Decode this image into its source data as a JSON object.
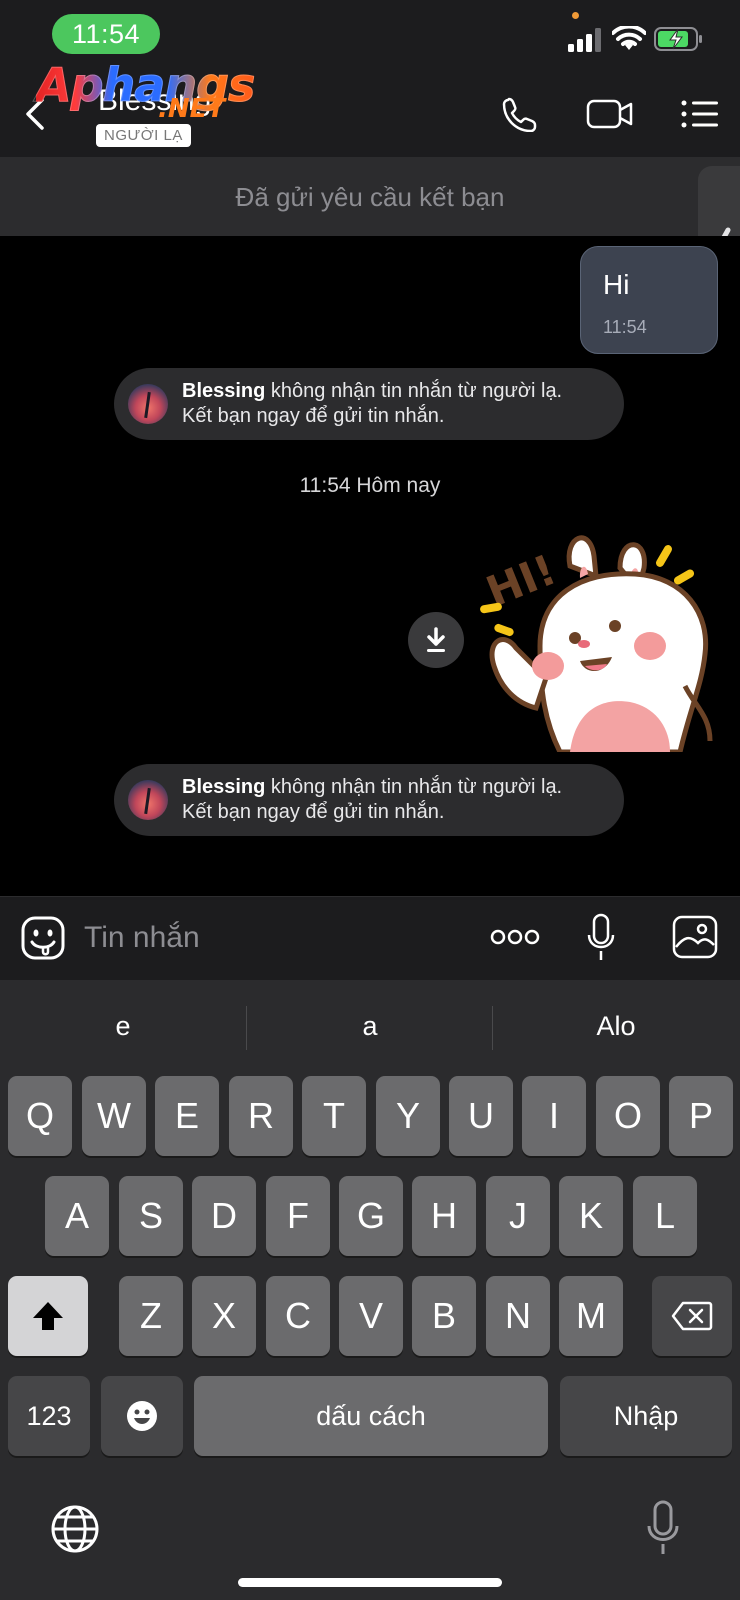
{
  "status": {
    "time": "11:54"
  },
  "header": {
    "contact_name": "Blessing",
    "stranger_tag": "NGƯỜI LẠ",
    "watermark_main": "Aphangs",
    "watermark_sub": ".NET"
  },
  "friend_banner": "Đã gửi yêu cầu kết bạn",
  "messages": {
    "outgoing": {
      "text": "Hi",
      "time": "11:54"
    },
    "notice": {
      "name": "Blessing",
      "line1_rest": " không nhận tin nhắn từ người lạ.",
      "line2": "Kết bạn ngay để gửi tin nhắn."
    },
    "time_divider": "11:54 Hôm nay",
    "sticker_text": "HI!"
  },
  "input": {
    "placeholder": "Tin nhắn"
  },
  "keyboard": {
    "suggestions": [
      "e",
      "a",
      "Alo"
    ],
    "row1": [
      "Q",
      "W",
      "E",
      "R",
      "T",
      "Y",
      "U",
      "I",
      "O",
      "P"
    ],
    "row2": [
      "A",
      "S",
      "D",
      "F",
      "G",
      "H",
      "J",
      "K",
      "L"
    ],
    "row3": [
      "Z",
      "X",
      "C",
      "V",
      "B",
      "N",
      "M"
    ],
    "numbers_label": "123",
    "space_label": "dấu cách",
    "return_label": "Nhập"
  },
  "colors": {
    "time_pill": "#4cc75e",
    "outgoing_bubble": "#3d4350",
    "keyboard_bg": "#2b2b2d"
  }
}
